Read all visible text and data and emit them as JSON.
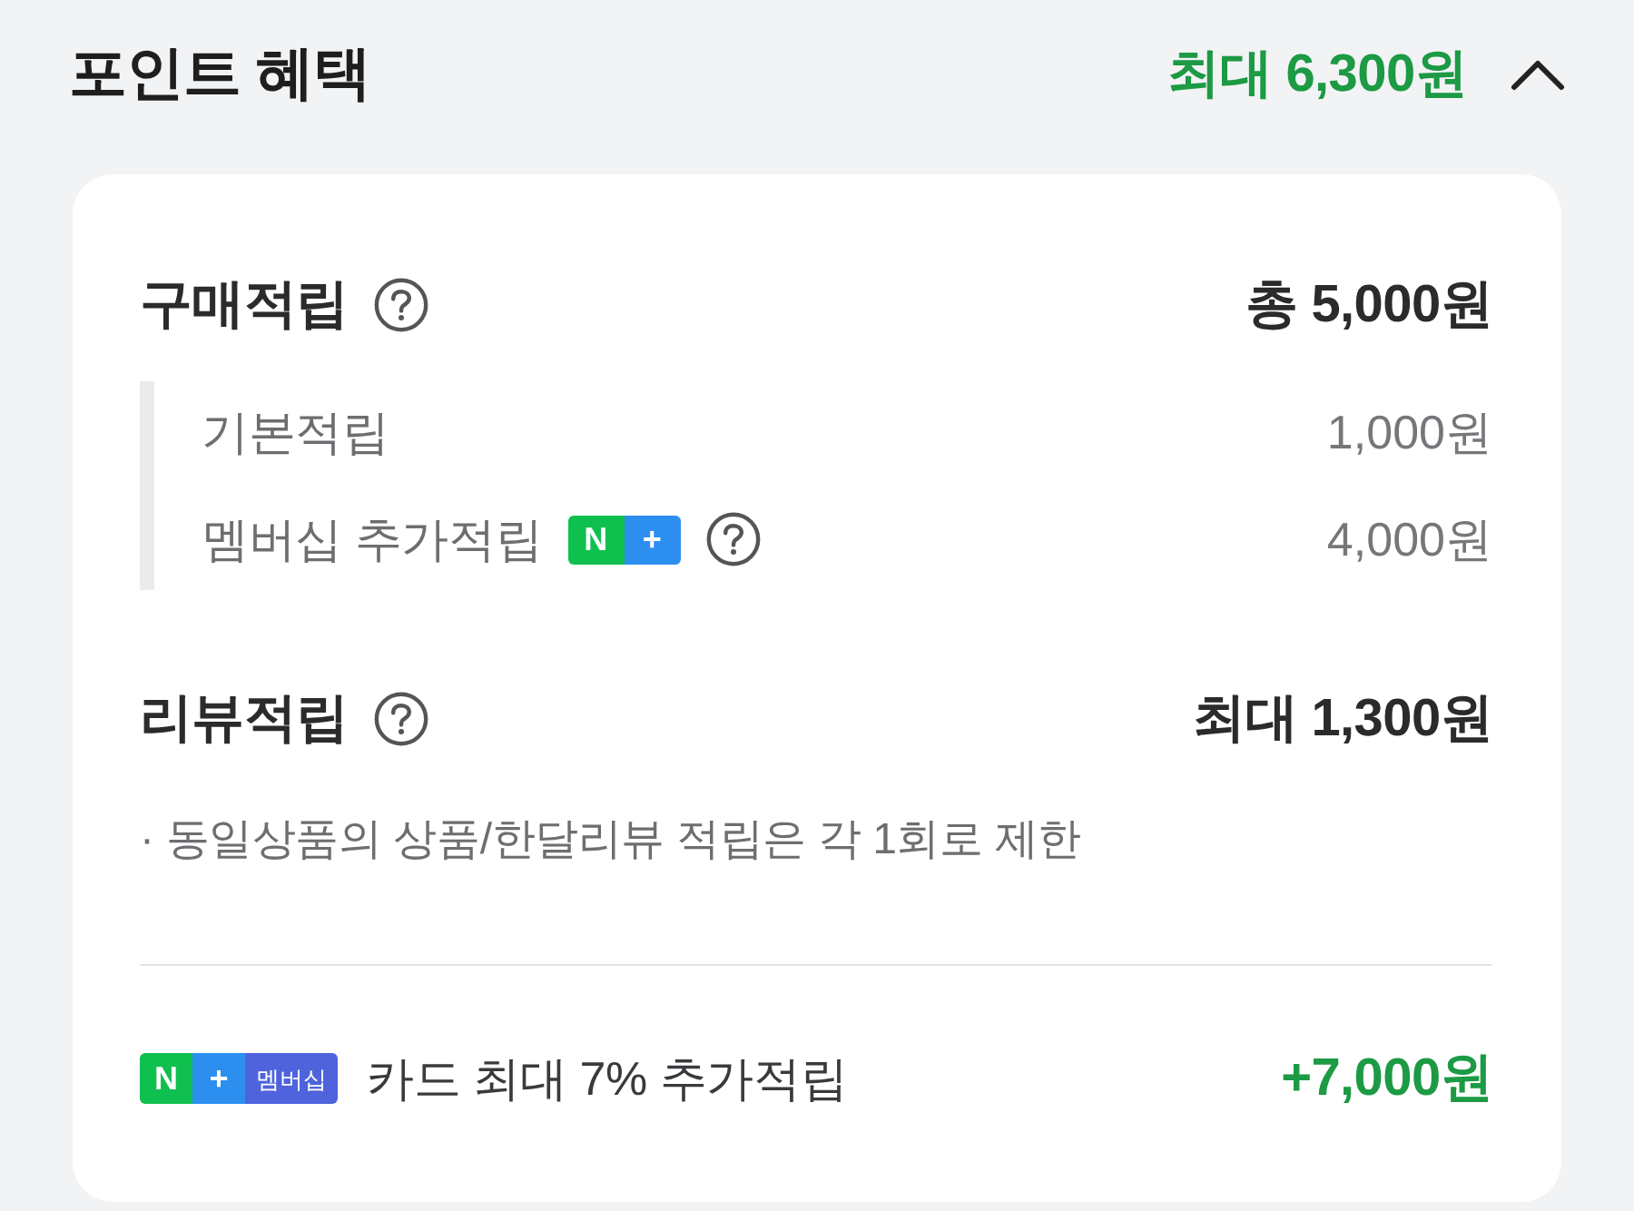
{
  "header": {
    "title": "포인트 혜택",
    "total": "최대 6,300원",
    "expanded": true
  },
  "purchase": {
    "label": "구매적립",
    "help": true,
    "amount": "총 5,000원",
    "items": [
      {
        "label": "기본적립",
        "help": false,
        "amount": "1,000원"
      },
      {
        "label": "멤버십 추가적립",
        "badge": {
          "n": "N",
          "plus": "+"
        },
        "help": true,
        "amount": "4,000원"
      }
    ]
  },
  "review": {
    "label": "리뷰적립",
    "help": true,
    "amount": "최대 1,300원",
    "note": "· 동일상품의 상품/한달리뷰 적립은 각 1회로 제한"
  },
  "card_offer": {
    "badge": {
      "n": "N",
      "plus": "+",
      "label": "멤버십"
    },
    "text": "카드 최대 7% 추가적립",
    "amount": "+7,000원"
  }
}
